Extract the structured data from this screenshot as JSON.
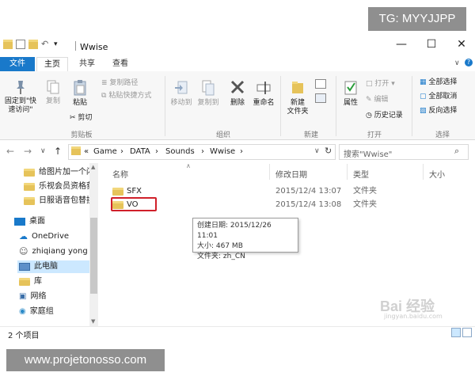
{
  "watermarks": {
    "top": "TG: MYYJJPP",
    "bottom": "www.projetonosso.com",
    "baidu": "Bai 经验",
    "baidu_sub": "jingyan.baidu.com"
  },
  "window": {
    "title": "Wwise",
    "qat_dropdown": "▾",
    "minimize": "—",
    "maximize": "☐",
    "close": "✕"
  },
  "tabs": [
    {
      "label": "文件"
    },
    {
      "label": "主页"
    },
    {
      "label": "共享"
    },
    {
      "label": "查看"
    }
  ],
  "ribbon": {
    "clipboard": {
      "pin": "固定到\"快\n速访问\"",
      "copy": "复制",
      "paste": "粘贴",
      "copy_path": "复制路径",
      "paste_shortcut": "粘贴快捷方式",
      "cut": "剪切",
      "label": "剪贴板"
    },
    "organize": {
      "move_to": "移动到",
      "copy_to": "复制到",
      "delete": "删除",
      "rename": "重命名",
      "label": "组织"
    },
    "new": {
      "new_folder": "新建\n文件夹",
      "label": "新建"
    },
    "open": {
      "properties": "属性",
      "open": "打开",
      "edit": "编辑",
      "history": "历史记录",
      "label": "打开"
    },
    "select": {
      "select_all": "全部选择",
      "select_none": "全部取消",
      "invert": "反向选择",
      "label": "选择"
    }
  },
  "address": {
    "back": "←",
    "forward": "→",
    "up": "↑",
    "overflow": "«",
    "crumbs": [
      "Game",
      "DATA",
      "Sounds",
      "Wwise"
    ],
    "search_placeholder": "搜索\"Wwise\""
  },
  "nav": {
    "items": [
      {
        "label": "给图片加一个闪"
      },
      {
        "label": "乐视会员资格获"
      },
      {
        "label": "日服语音包替换"
      },
      {
        "label": "桌面"
      },
      {
        "label": "OneDrive"
      },
      {
        "label": "zhiqiang yong"
      },
      {
        "label": "此电脑"
      },
      {
        "label": "库"
      },
      {
        "label": "网络"
      },
      {
        "label": "家庭组"
      }
    ]
  },
  "columns": {
    "name": "名称",
    "modified": "修改日期",
    "type": "类型",
    "size": "大小"
  },
  "files": [
    {
      "name": "SFX",
      "modified": "2015/12/4 13:07",
      "type": "文件夹"
    },
    {
      "name": "VO",
      "modified": "2015/12/4 13:08",
      "type": "文件夹"
    }
  ],
  "tooltip": {
    "created": "创建日期: 2015/12/26 11:01",
    "size": "大小: 467 MB",
    "folders": "文件夹: zh_CN"
  },
  "status": {
    "count": "2 个项目"
  },
  "colors": {
    "accent": "#1979ca",
    "highlight": "#d0202a",
    "folder": "#e6c35a"
  }
}
